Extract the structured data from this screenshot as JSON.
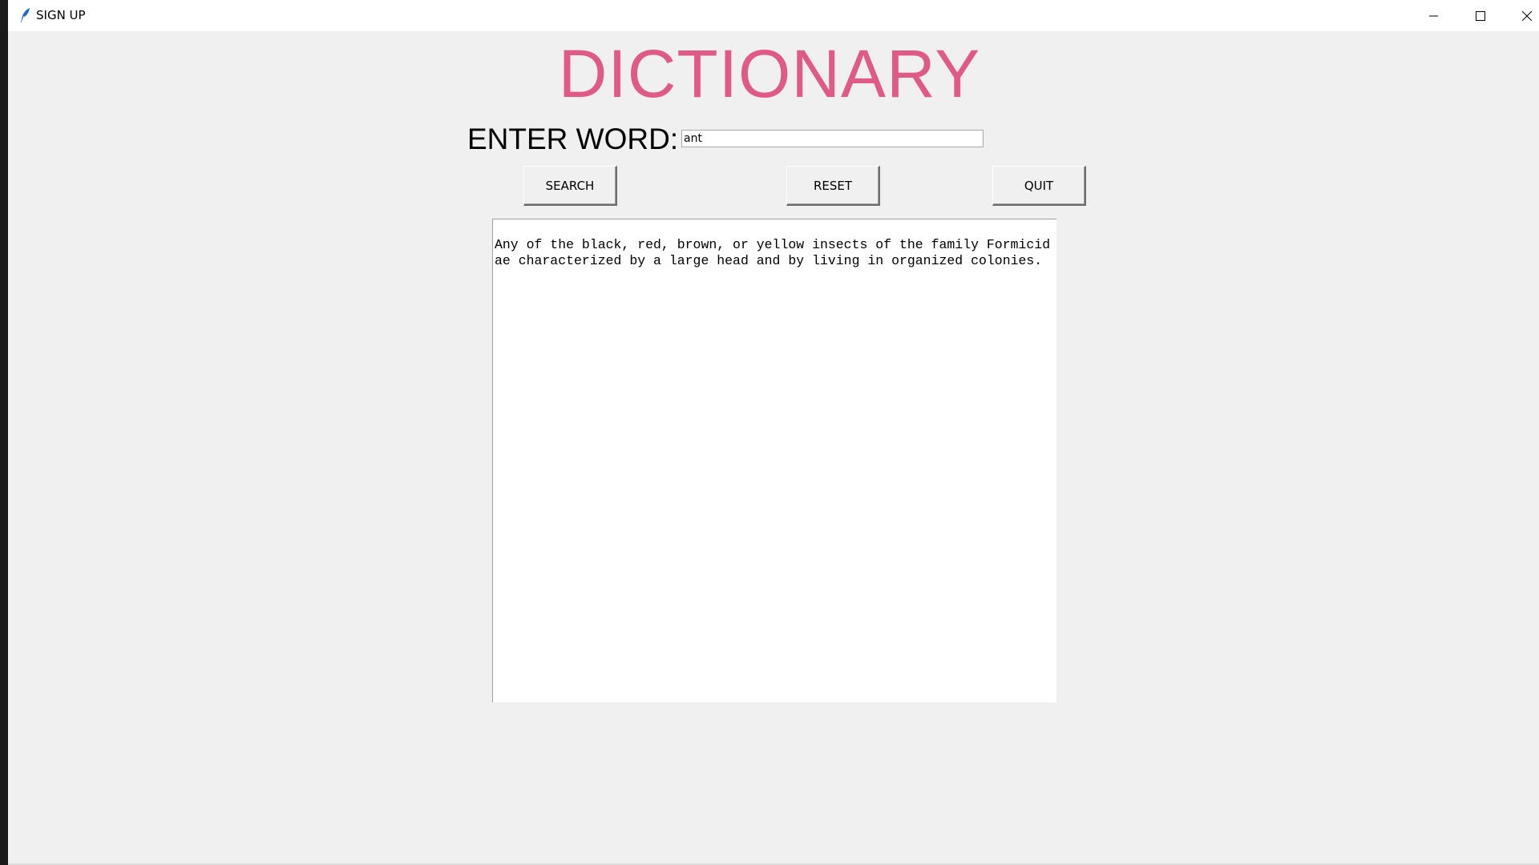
{
  "window": {
    "title": "SIGN UP",
    "controls": {
      "minimize": "minimize-icon",
      "maximize": "maximize-icon",
      "close": "close-icon"
    }
  },
  "heading": "DICTIONARY",
  "form": {
    "label": "ENTER WORD:",
    "input_value": "ant"
  },
  "buttons": {
    "search": "SEARCH",
    "reset": "RESET",
    "quit": "QUIT"
  },
  "result": {
    "text": "Any of the black, red, brown, or yellow insects of the family Formicidae characterized by a large head and by living in organized colonies."
  },
  "colors": {
    "heading": "#e05a87",
    "background": "#f0f0f0"
  }
}
